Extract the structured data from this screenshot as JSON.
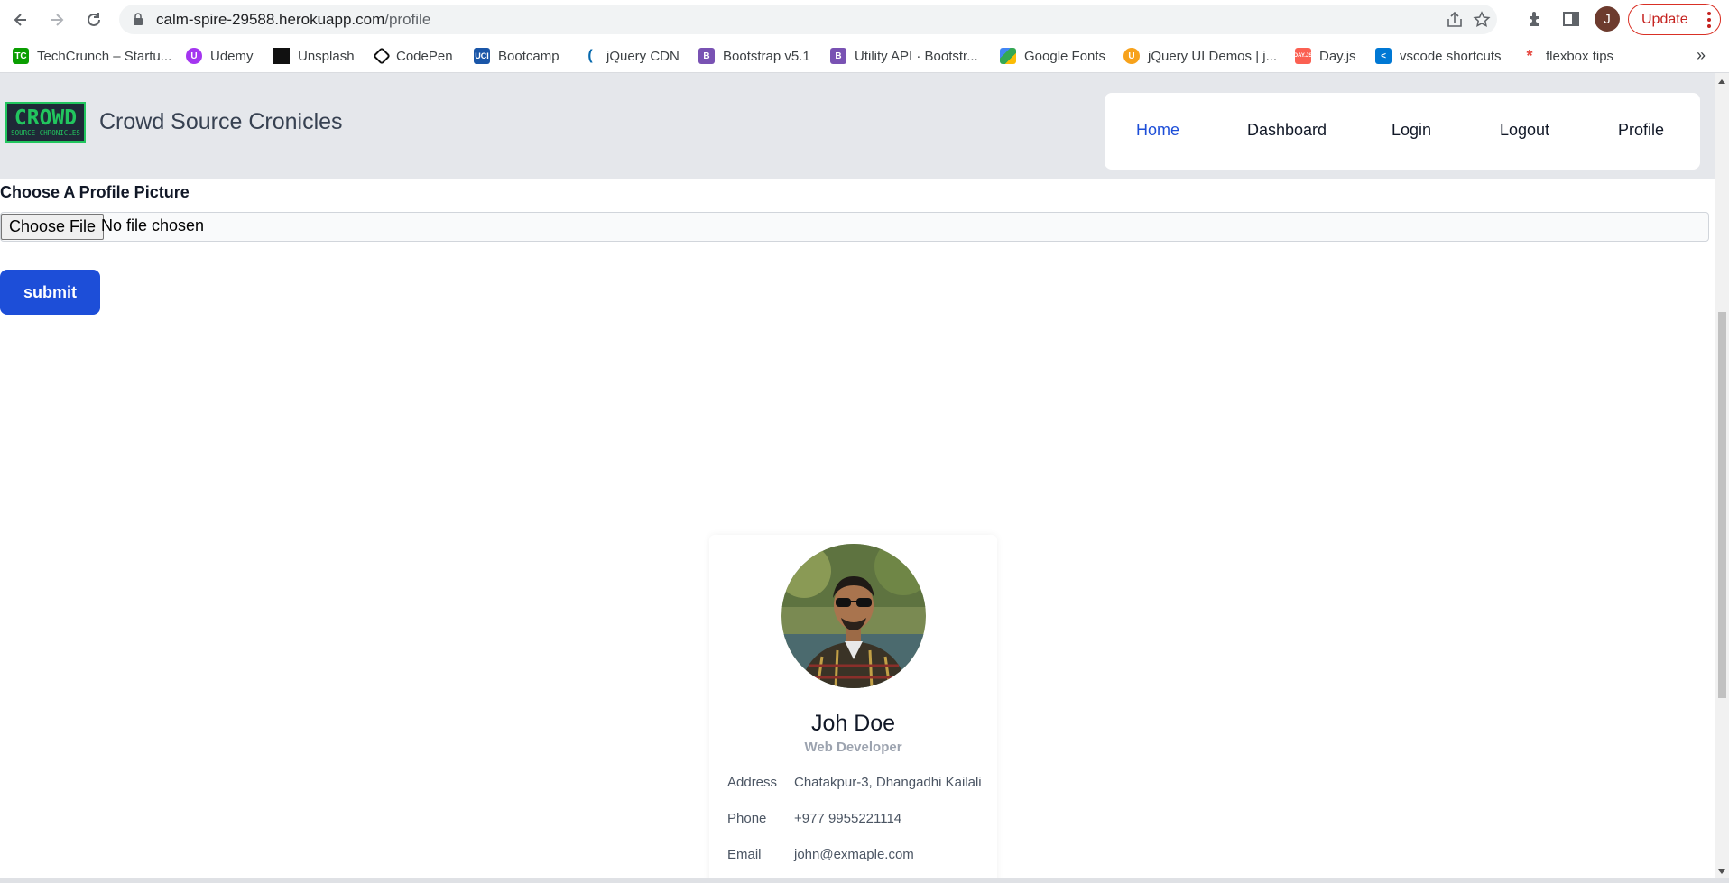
{
  "browser": {
    "url_host": "calm-spire-29588.herokuapp.com",
    "url_path": "/profile",
    "profile_initial": "J",
    "update_label": "Update",
    "bookmarks": [
      {
        "label": "TechCrunch – Startu...",
        "icon": "techcrunch-icon",
        "color": "#0a9e01"
      },
      {
        "label": "Udemy",
        "icon": "udemy-icon",
        "color": "#a435f0"
      },
      {
        "label": "Unsplash",
        "icon": "unsplash-icon",
        "color": "#111111"
      },
      {
        "label": "CodePen",
        "icon": "codepen-icon",
        "color": "#111111"
      },
      {
        "label": "Bootcamp",
        "icon": "bootcamp-icon",
        "color": "#1a56a8"
      },
      {
        "label": "jQuery CDN",
        "icon": "jquery-icon",
        "color": "#0769ad"
      },
      {
        "label": "Bootstrap v5.1",
        "icon": "bootstrap-icon",
        "color": "#7952b3"
      },
      {
        "label": "Utility API · Bootstr...",
        "icon": "bootstrap-icon",
        "color": "#7952b3"
      },
      {
        "label": "Google Fonts",
        "icon": "google-fonts-icon",
        "color": "#4285f4"
      },
      {
        "label": "jQuery UI Demos | j...",
        "icon": "jquery-ui-icon",
        "color": "#f7a21b"
      },
      {
        "label": "Day.js",
        "icon": "dayjs-icon",
        "color": "#fb6052"
      },
      {
        "label": "vscode shortcuts",
        "icon": "vscode-icon",
        "color": "#0078d4"
      },
      {
        "label": "flexbox tips",
        "icon": "flexbox-icon",
        "color": "#e5433b"
      }
    ],
    "bookmarks_more": "»"
  },
  "site": {
    "logo_big": "CROWD",
    "logo_small": "SOURCE CHRONICLES",
    "brand": "Crowd Source Cronicles",
    "nav": [
      "Home",
      "Dashboard",
      "Login",
      "Logout",
      "Profile"
    ],
    "active_nav": "Home",
    "accent_color": "#1d4ed8"
  },
  "form": {
    "label": "Choose A Profile Picture",
    "file_button": "Choose File",
    "file_status": "No file chosen",
    "submit": "submit"
  },
  "profile": {
    "name": "Joh Doe",
    "role": "Web Developer",
    "rows": [
      {
        "key": "Address",
        "value": "Chatakpur-3, Dhangadhi Kailali"
      },
      {
        "key": "Phone",
        "value": "+977 9955221114"
      },
      {
        "key": "Email",
        "value": "john@exmaple.com"
      }
    ]
  }
}
